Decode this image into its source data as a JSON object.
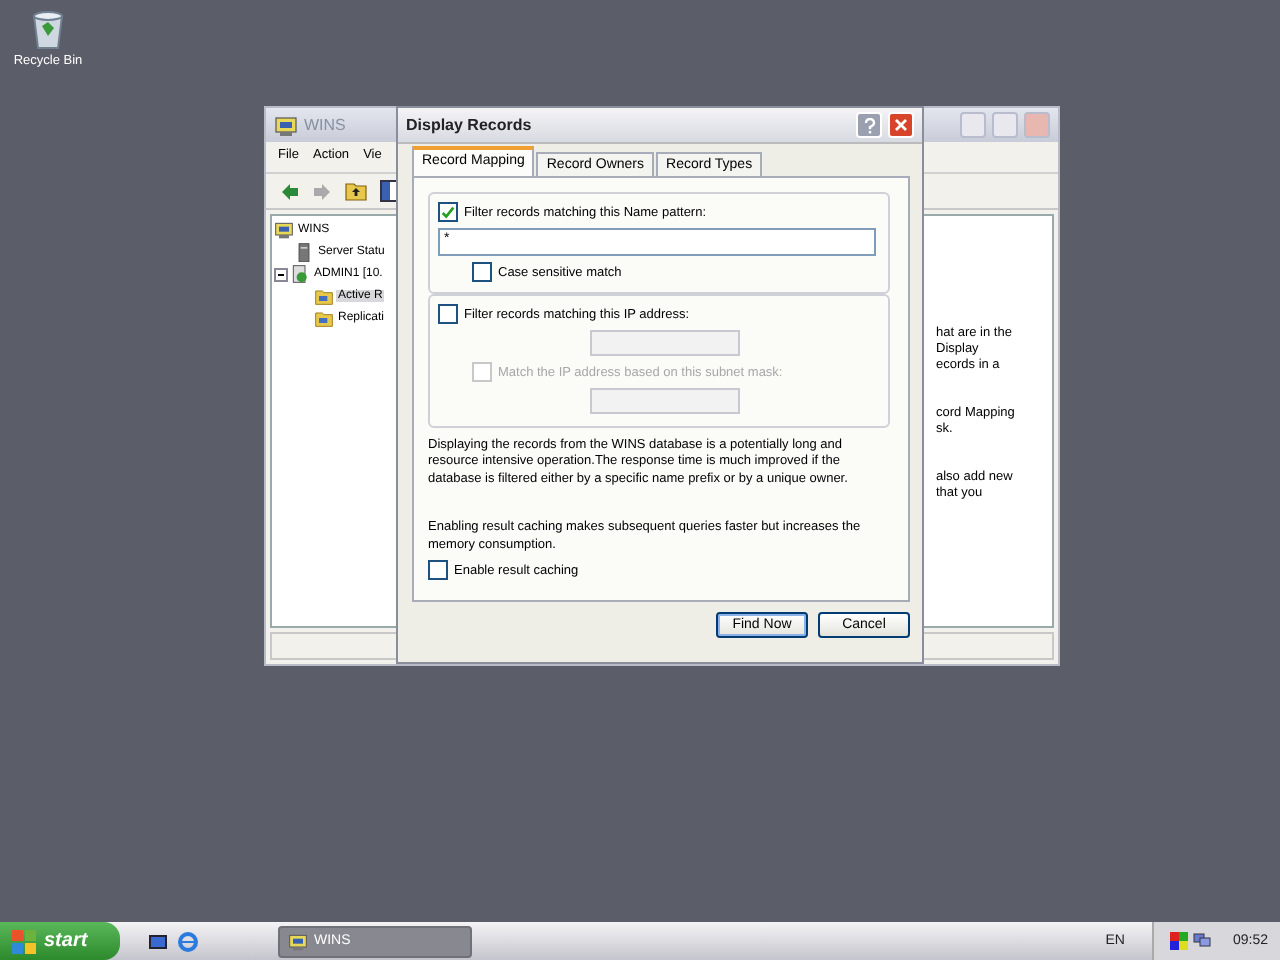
{
  "desktop_icons": [
    {
      "label": "Recycle Bin"
    }
  ],
  "background_window": {
    "title": "WINS",
    "menu": [
      "File",
      "Action",
      "Vie"
    ],
    "tree": [
      {
        "label": "WINS",
        "children": [
          {
            "label": "Server Statu"
          },
          {
            "label": "ADMIN1 [10.",
            "expanded": true,
            "children": [
              {
                "label": "Active R",
                "selected": true
              },
              {
                "label": "Replicati",
                "selected": false
              }
            ]
          }
        ]
      }
    ],
    "pane_text": [
      [
        "hat are in the",
        "Display",
        "ecords in a"
      ],
      [
        "cord Mapping",
        "sk."
      ],
      [
        "also add new",
        "that you"
      ]
    ]
  },
  "dialog": {
    "title": "Display Records",
    "tabs": [
      {
        "label": "Record Mapping",
        "selected": true
      },
      {
        "label": "Record Owners",
        "selected": false
      },
      {
        "label": "Record Types",
        "selected": false
      }
    ],
    "name_filter": {
      "label": "Filter records matching this Name pattern:",
      "checked": true,
      "value": "*"
    },
    "case_sensitive": {
      "label": "Case sensitive match",
      "checked": false
    },
    "ip_filter": {
      "label": "Filter records matching this IP address:",
      "checked": false
    },
    "subnet_match": {
      "label": "Match the IP address based on this subnet mask:",
      "checked": false,
      "disabled": true
    },
    "paragraphs": [
      "Displaying the records from the WINS database is a potentially long and resource intensive operation.The response time is much improved if the database is filtered either by a specific name prefix or by a unique owner.",
      "Enabling result caching makes subsequent queries faster but increases the memory consumption."
    ],
    "caching": {
      "label": "Enable result caching",
      "checked": false
    },
    "buttons": [
      "Find Now",
      "Cancel"
    ]
  },
  "taskbar": {
    "start": "start",
    "tasks": [
      {
        "label": "WINS",
        "selected": false
      }
    ],
    "language": "EN",
    "clock": "09:52"
  }
}
